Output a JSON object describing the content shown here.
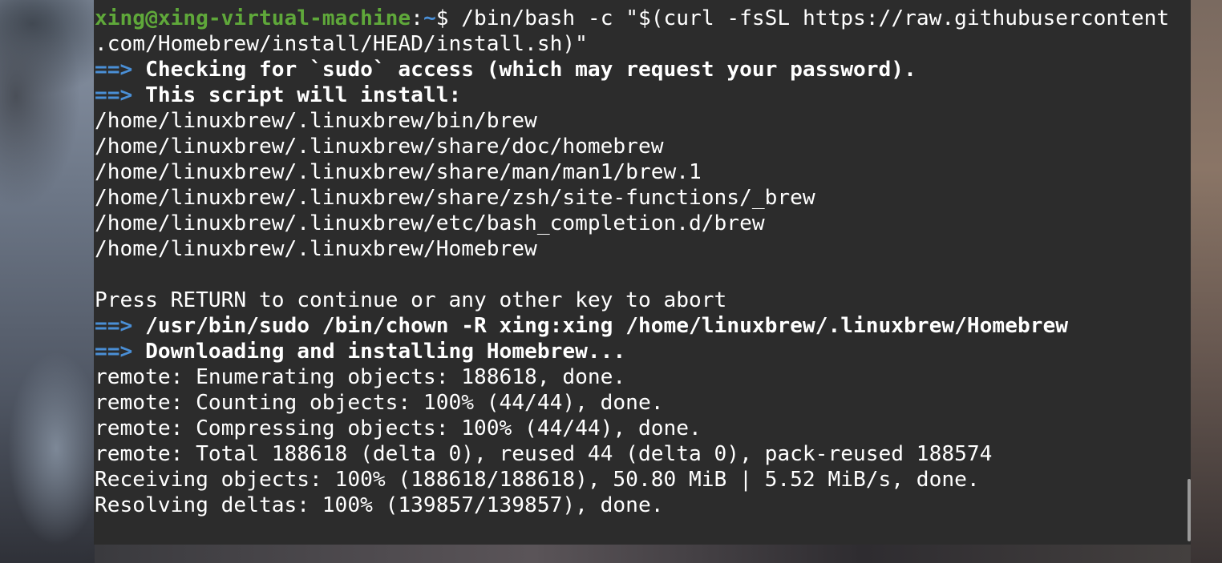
{
  "terminal": {
    "prompt": {
      "user_host": "xing@xing-virtual-machine",
      "colon": ":",
      "path": "~",
      "symbol": "$ ",
      "command_part1": "/bin/bash -c \"$(curl -fsSL https://raw.githubusercontent",
      "command_part2": ".com/Homebrew/install/HEAD/install.sh)\""
    },
    "arrow": "==>",
    "lines": {
      "check_sudo": "Checking for `sudo` access (which may request your password).",
      "script_install": "This script will install:",
      "path1": "/home/linuxbrew/.linuxbrew/bin/brew",
      "path2": "/home/linuxbrew/.linuxbrew/share/doc/homebrew",
      "path3": "/home/linuxbrew/.linuxbrew/share/man/man1/brew.1",
      "path4": "/home/linuxbrew/.linuxbrew/share/zsh/site-functions/_brew",
      "path5": "/home/linuxbrew/.linuxbrew/etc/bash_completion.d/brew",
      "path6": "/home/linuxbrew/.linuxbrew/Homebrew",
      "press_return": "Press RETURN to continue or any other key to abort",
      "chown": "/usr/bin/sudo /bin/chown -R xing:xing /home/linuxbrew/.linuxbrew/Homebrew",
      "downloading": "Downloading and installing Homebrew...",
      "enumerating": "remote: Enumerating objects: 188618, done.",
      "counting": "remote: Counting objects: 100% (44/44), done.",
      "compressing": "remote: Compressing objects: 100% (44/44), done.",
      "total": "remote: Total 188618 (delta 0), reused 44 (delta 0), pack-reused 188574",
      "receiving": "Receiving objects: 100% (188618/188618), 50.80 MiB | 5.52 MiB/s, done.",
      "resolving": "Resolving deltas: 100% (139857/139857), done."
    }
  },
  "colors": {
    "terminal_bg": "#2c2c2c",
    "prompt_user": "#5fa83a",
    "prompt_path": "#4a8fd6",
    "arrow": "#4a8fd6",
    "text": "#ffffff"
  }
}
